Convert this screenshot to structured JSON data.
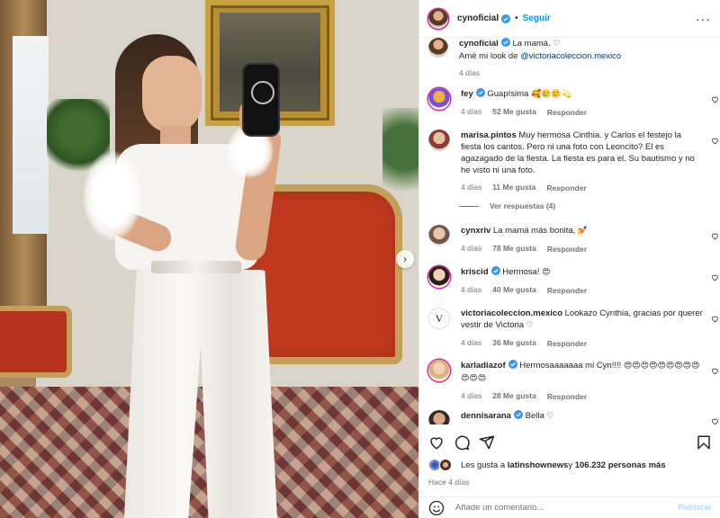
{
  "post_header": {
    "username": "cynoficial",
    "separator": "•",
    "follow_label": "Seguir",
    "more_label": "···"
  },
  "caption": {
    "username": "cynoficial",
    "text_line1": "La mamá. ",
    "heart": "♡",
    "text_line2": "Amé mi look de ",
    "mention": "@victoriacoleccion.mexico",
    "age": "4 días"
  },
  "comments": [
    {
      "username": "fey",
      "verified": true,
      "text": "Guapísima ",
      "emoji": "🥰🥲🥲💫",
      "age": "4 días",
      "likes": "52 Me gusta",
      "reply": "Responder"
    },
    {
      "username": "marisa.pintos",
      "verified": false,
      "text": "Muy hermosa Cinthia. y Carlos el festejo la fiesta los cantos. Pero ni una foto con Leoncito? El es agazagado de la fiesta. La fiesta es para el. Su bautismo y no he visto ni una foto.",
      "age": "4 días",
      "likes": "11 Me gusta",
      "reply": "Responder",
      "replies_label": "Ver respuestas (4)"
    },
    {
      "username": "cynxriv",
      "verified": false,
      "text": "La mamá más bonita, ",
      "emoji": "💅",
      "age": "4 días",
      "likes": "78 Me gusta",
      "reply": "Responder"
    },
    {
      "username": "kriscid",
      "verified": true,
      "text": "Hermosa! ",
      "emoji": "😍",
      "age": "4 días",
      "likes": "40 Me gusta",
      "reply": "Responder"
    },
    {
      "username": "victoriacoleccion.mexico",
      "verified": false,
      "text": "Lookazo Cynthia, gracias por querer vestir de Victoria ",
      "emoji": "♡",
      "age": "4 días",
      "likes": "36 Me gusta",
      "reply": "Responder"
    },
    {
      "username": "karladiazof",
      "verified": true,
      "text": "Hermosaaaaaaa mi Cyn!!!! ",
      "emoji": "😍😍😍😍😍😍😍😍😍😍😍😍",
      "age": "4 días",
      "likes": "28 Me gusta",
      "reply": "Responder"
    },
    {
      "username": "dennisarana",
      "verified": true,
      "text": "Bella ",
      "emoji": "♡"
    }
  ],
  "likes_summary": {
    "prefix": "Les gusta a ",
    "user": "latinshownews",
    "middle": " y ",
    "count": "106.232 personas más"
  },
  "post_time": "Hace 4 días",
  "add_comment": {
    "placeholder": "Añade un comentario...",
    "publish_label": "Publicar"
  },
  "colors": {
    "link_blue": "#0095f6",
    "mention_blue": "#00376b",
    "verified_blue": "#3897f0",
    "muted": "#737373"
  },
  "icons": [
    "heart-icon",
    "comment-icon",
    "share-icon",
    "save-icon",
    "emoji-icon",
    "verified-icon",
    "more-icon",
    "chevron-right-icon"
  ]
}
